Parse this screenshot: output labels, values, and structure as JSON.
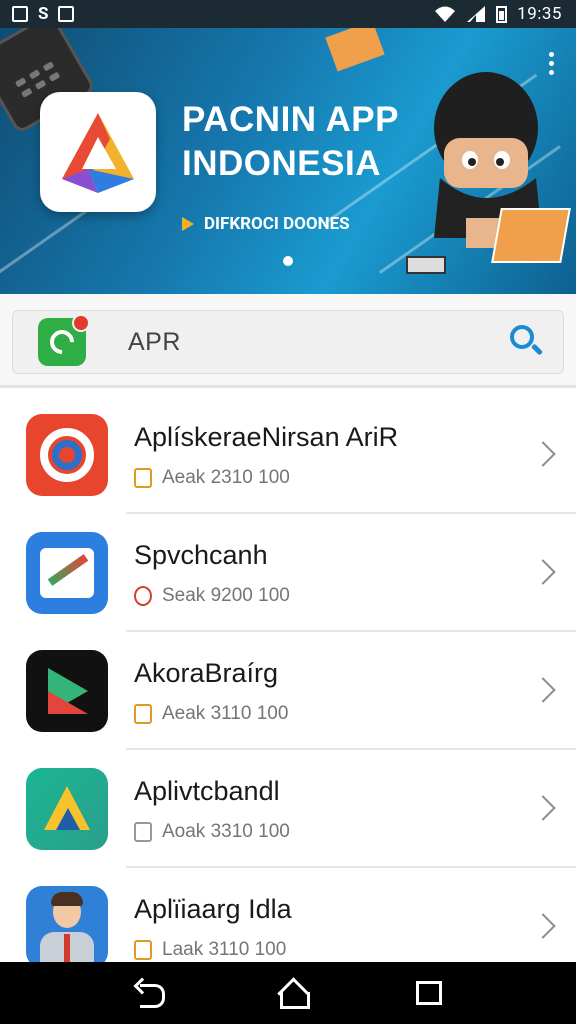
{
  "status_bar": {
    "time": "19:35",
    "left_icons": [
      "image-icon",
      "s-icon",
      "photo-icon"
    ],
    "right_icons": [
      "wifi-icon",
      "signal-icon",
      "battery-icon"
    ],
    "s_label": "S"
  },
  "banner": {
    "title_line1": "PACNIN APP",
    "title_line2": "INDONESIA",
    "subtitle": "DIFKROCI DOONES",
    "active_slide": 1
  },
  "search": {
    "value": "APR"
  },
  "apps": [
    {
      "name": "AplískeraeNirsan AriR",
      "meta": "Aeak 2310 100",
      "icon": "target-app-icon"
    },
    {
      "name": "Spvchcanh",
      "meta": "Seak 9200 100",
      "icon": "gallery-app-icon"
    },
    {
      "name": "AkoraBraírg",
      "meta": "Aeak 3110 100",
      "icon": "play-app-icon"
    },
    {
      "name": "Aplivtcbandl",
      "meta": "Aoak 3310 100",
      "icon": "drive-app-icon"
    },
    {
      "name": "Aplïiaarg Idla",
      "meta": "Laak 3110 100",
      "icon": "avatar-app-icon"
    }
  ],
  "colors": {
    "status_bar": "#1b2a33",
    "banner_accent": "#1a9bd0",
    "search_icon": "#1a8bd6",
    "nav_bar": "#000000"
  }
}
